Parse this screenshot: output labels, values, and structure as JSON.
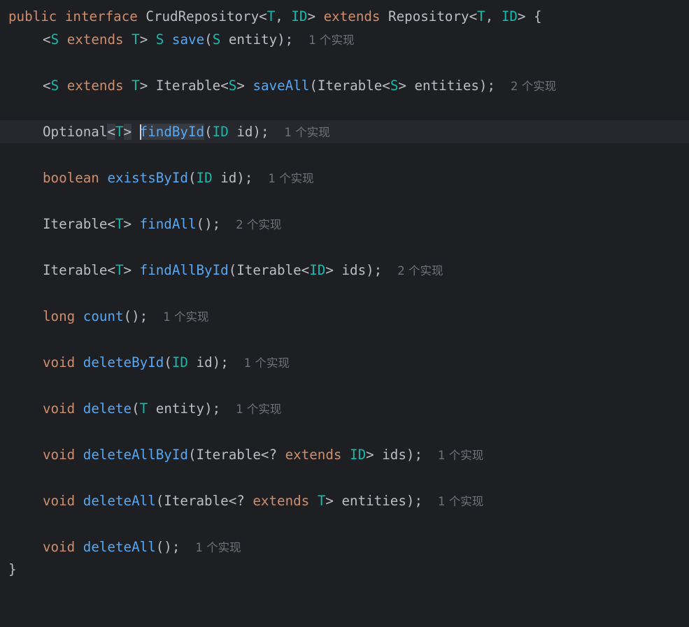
{
  "editor": {
    "decl": {
      "public": "public",
      "interface": "interface",
      "name": "CrudRepository",
      "lt": "<",
      "T": "T",
      "comma": ", ",
      "ID": "ID",
      "gt": ">",
      "extends": "extends",
      "super_name": "Repository",
      "open": " {"
    },
    "methods": [
      {
        "hint": "1 个实现"
      },
      {
        "hint": "2 个实现"
      },
      {
        "hint": "1 个实现"
      },
      {
        "hint": "1 个实现"
      },
      {
        "hint": "2 个实现"
      },
      {
        "hint": "2 个实现"
      },
      {
        "hint": "1 个实现"
      },
      {
        "hint": "1 个实现"
      },
      {
        "hint": "1 个实现"
      },
      {
        "hint": "1 个实现"
      },
      {
        "hint": "1 个实现"
      },
      {
        "hint": "1 个实现"
      }
    ],
    "close": "}"
  }
}
